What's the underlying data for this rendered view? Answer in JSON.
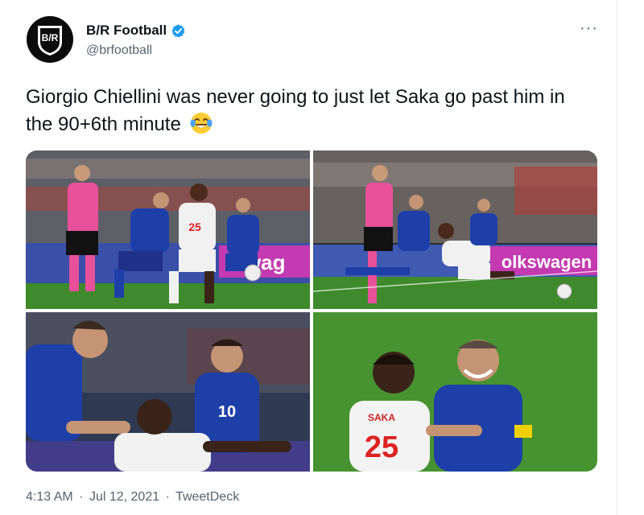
{
  "author": {
    "name": "B/R Football",
    "handle": "@brfootball",
    "avatar_text": "B/R",
    "verified_icon": "verified-badge-icon"
  },
  "more_label": "···",
  "tweet": {
    "text": "Giorgio Chiellini was never going to just let Saka go past him in the 90+6th minute",
    "emoji": "face-with-tears-of-joy"
  },
  "media": {
    "photos": [
      {
        "description": "photo-1",
        "board_text": "swag"
      },
      {
        "description": "photo-2",
        "board_text": "olkswagen"
      },
      {
        "description": "photo-3",
        "shirt_number": "10"
      },
      {
        "description": "photo-4",
        "shirt_name": "SAKA",
        "shirt_number": "25"
      }
    ]
  },
  "meta": {
    "time": "4:13 AM",
    "sep1": "·",
    "date": "Jul 12, 2021",
    "sep2": "·",
    "source": "TweetDeck"
  },
  "colors": {
    "verified_blue": "#1d9bf0",
    "text": "#0f1419",
    "muted": "#536471",
    "italy_blue": "#1e3fa8",
    "referee_pink": "#e8509a",
    "pitch_green": "#3e8a2c"
  }
}
